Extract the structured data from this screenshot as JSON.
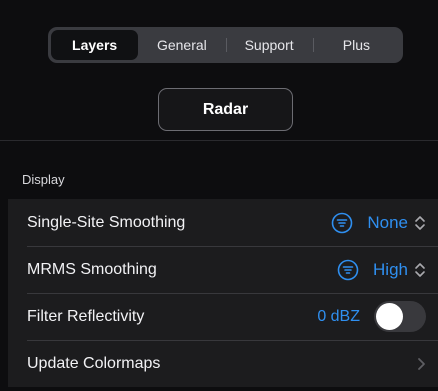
{
  "tabs": [
    {
      "label": "Layers",
      "active": true
    },
    {
      "label": "General",
      "active": false
    },
    {
      "label": "Support",
      "active": false
    },
    {
      "label": "Plus",
      "active": false
    }
  ],
  "radar_button": {
    "label": "Radar"
  },
  "display_section": {
    "header": "Display",
    "rows": [
      {
        "label": "Single-Site Smoothing",
        "value": "None",
        "icon": "filter-icon",
        "control": "up-down-selector"
      },
      {
        "label": "MRMS Smoothing",
        "value": "High",
        "icon": "filter-icon",
        "control": "up-down-selector"
      },
      {
        "label": "Filter Reflectivity",
        "value": "0 dBZ",
        "control": "toggle",
        "toggle_on": false
      },
      {
        "label": "Update Colormaps",
        "control": "chevron-right-icon"
      }
    ]
  },
  "colors": {
    "accent": "#2f8ff0",
    "background": "#0d0d0f",
    "row_background": "#1c1c1e",
    "segment_background": "#3a3b40"
  }
}
